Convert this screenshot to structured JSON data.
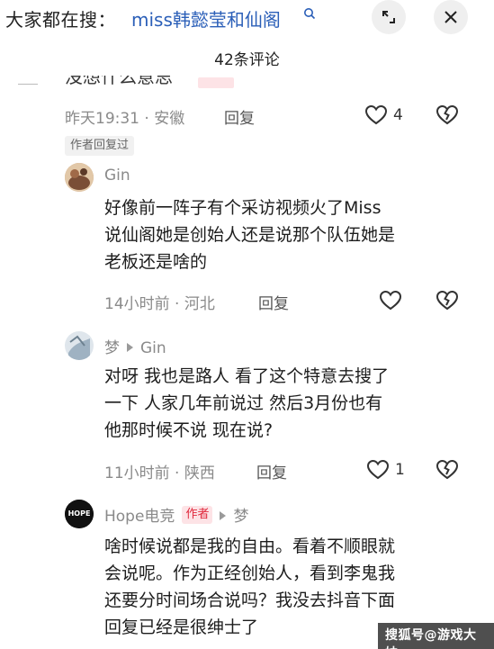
{
  "search": {
    "prefix": "大家都在搜：",
    "term": "miss韩懿莹和仙阁"
  },
  "header": {
    "comment_count": "42条评论"
  },
  "comments": [
    {
      "cut_text": "没想什么意思",
      "time": "昨天19:31",
      "location": "安徽",
      "reply_label": "回复",
      "likes": "4",
      "tag": "作者回复过"
    },
    {
      "username": "Gin",
      "lines": [
        "好像前一阵子有个采访视频火了Miss",
        "说仙阁她是创始人还是说那个队伍她是",
        "老板还是啥的"
      ],
      "time": "14小时前",
      "location": "河北",
      "reply_label": "回复",
      "likes": ""
    },
    {
      "username": "梦",
      "reply_to": "Gin",
      "lines": [
        "对呀 我也是路人 看了这个特意去搜了",
        "一下 人家几年前说过 然后3月份也有",
        "他那时候不说 现在说?"
      ],
      "time": "11小时前",
      "location": "陕西",
      "reply_label": "回复",
      "likes": "1"
    },
    {
      "username": "Hope电竞",
      "badge": "作者",
      "reply_to": "梦",
      "lines": [
        "啥时候说都是我的自由。看着不顺眼就",
        "会说呢。作为正经创始人，看到李鬼我",
        "还要分时间场合说吗？我没去抖音下面",
        "回复已经是很绅士了"
      ]
    }
  ],
  "avatar_hope_text": "HOPE",
  "watermark": "搜狐号@游戏大妹",
  "colors": {
    "link_blue": "#2b5fb8",
    "badge_bg": "#fde3e6",
    "badge_text": "#e0283c",
    "meta_gray": "#8a8a8a"
  }
}
